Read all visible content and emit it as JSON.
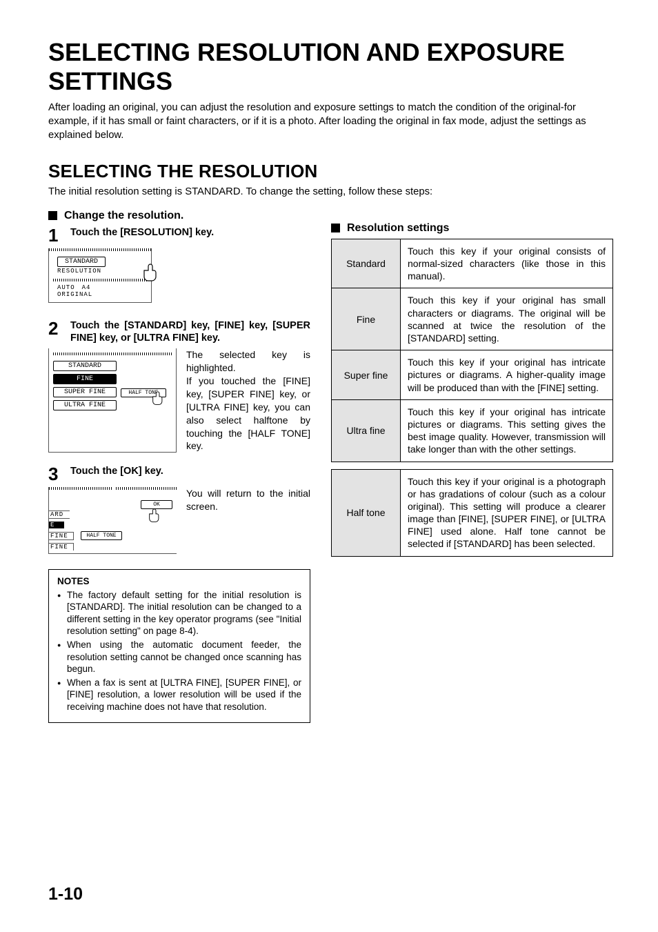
{
  "page": {
    "title": "SELECTING RESOLUTION AND EXPOSURE SETTINGS",
    "intro": "After loading an original, you can adjust the resolution and exposure settings to match the condition of the original-for example, if it has small or faint characters, or if it is a photo. After loading the original in fax mode, adjust the settings as explained below.",
    "section_title": "SELECTING THE RESOLUTION",
    "section_sub": "The initial resolution setting is STANDARD. To change the setting, follow these steps:",
    "page_number": "1-10"
  },
  "subhead_left": "Change the resolution.",
  "subhead_right": "Resolution settings",
  "steps": {
    "1": {
      "title": "Touch the [RESOLUTION] key.",
      "illus": {
        "btn1": "STANDARD",
        "label1": "RESOLUTION",
        "row2a": "AUTO",
        "row2b": "A4",
        "label2": "ORIGINAL"
      }
    },
    "2": {
      "title": "Touch the [STANDARD] key, [FINE] key, [SUPER FINE] key, or [ULTRA FINE] key.",
      "desc": "The selected key is highlighted.\nIf you touched the [FINE] key, [SUPER FINE] key, or [ULTRA FINE] key, you can also select halftone by touching the [HALF TONE] key.",
      "illus": {
        "b1": "STANDARD",
        "b2": "FINE",
        "b3": "SUPER FINE",
        "b4": "ULTRA FINE",
        "half": "HALF TONE"
      }
    },
    "3": {
      "title": "Touch the [OK] key.",
      "desc": "You will return to the initial screen.",
      "illus": {
        "ok": "OK",
        "t1": "ARD",
        "t2": "E",
        "t3": "FINE",
        "t4": "FINE",
        "half": "HALF TONE"
      }
    }
  },
  "notes": {
    "title": "NOTES",
    "items": [
      "The factory default setting for the initial resolution is [STANDARD]. The initial resolution can be changed to a different setting in the key operator programs (see \"Initial resolution setting\" on page 8-4).",
      "When using the automatic document feeder, the resolution setting cannot be changed once scanning has begun.",
      "When a fax is sent at [ULTRA FINE], [SUPER FINE], or [FINE] resolution, a lower resolution will be used if the receiving machine does not have that resolution."
    ]
  },
  "table1": [
    {
      "label": "Standard",
      "desc": "Touch this key if your original consists of normal-sized characters (like those in this manual)."
    },
    {
      "label": "Fine",
      "desc": "Touch this key if your original has small characters or diagrams. The original will be scanned at twice the resolution of the [STANDARD] setting."
    },
    {
      "label": "Super fine",
      "desc": "Touch this key if your original has intricate pictures or diagrams. A higher-quality image will be produced than with the [FINE] setting."
    },
    {
      "label": "Ultra fine",
      "desc": "Touch this key if your original has intricate pictures or diagrams. This setting gives the best image quality. However, transmission will take longer than with the other settings."
    }
  ],
  "table2": [
    {
      "label": "Half tone",
      "desc": "Touch this key if your original is a photograph or has gradations of colour (such as a colour original). This setting will produce a clearer image than [FINE], [SUPER FINE], or [ULTRA FINE] used alone. Half tone cannot be selected if [STANDARD] has been selected."
    }
  ]
}
